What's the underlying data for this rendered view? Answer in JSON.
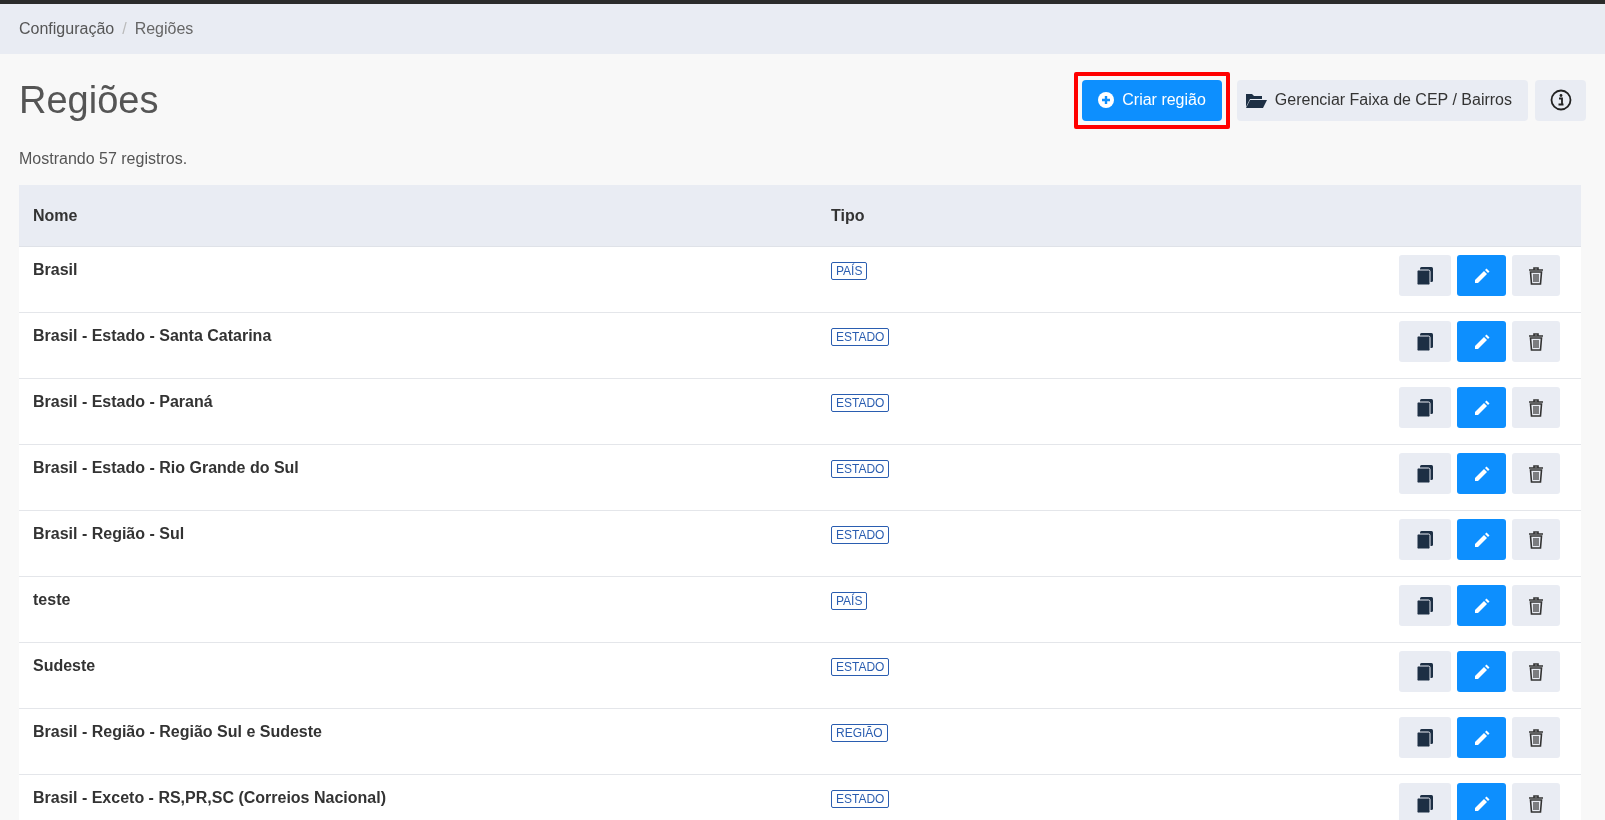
{
  "breadcrumb_separator": "/",
  "breadcrumb": [
    {
      "label": "Configuração",
      "current": false
    },
    {
      "label": "Regiões",
      "current": true
    }
  ],
  "page": {
    "title": "Regiões",
    "record_count": "Mostrando 57 registros."
  },
  "toolbar": [
    {
      "kind": "primary",
      "label": "Criar região",
      "highlighted": true
    },
    {
      "kind": "secondary",
      "label": "Gerenciar Faixa de CEP / Bairros",
      "highlighted": false
    },
    {
      "kind": "info",
      "highlighted": false
    }
  ],
  "table": {
    "columns": [
      "Nome",
      "Tipo"
    ],
    "rows": [
      {
        "name": "Brasil",
        "type": "PAÍS"
      },
      {
        "name": "Brasil - Estado - Santa Catarina",
        "type": "ESTADO"
      },
      {
        "name": "Brasil - Estado - Paraná",
        "type": "ESTADO"
      },
      {
        "name": "Brasil - Estado - Rio Grande do Sul",
        "type": "ESTADO"
      },
      {
        "name": "Brasil - Região - Sul",
        "type": "ESTADO"
      },
      {
        "name": "teste",
        "type": "PAÍS"
      },
      {
        "name": "Sudeste",
        "type": "ESTADO"
      },
      {
        "name": "Brasil - Região - Região Sul e Sudeste",
        "type": "REGIÃO"
      },
      {
        "name": "Brasil - Exceto - RS,PR,SC (Correios Nacional)",
        "type": "ESTADO"
      }
    ]
  }
}
